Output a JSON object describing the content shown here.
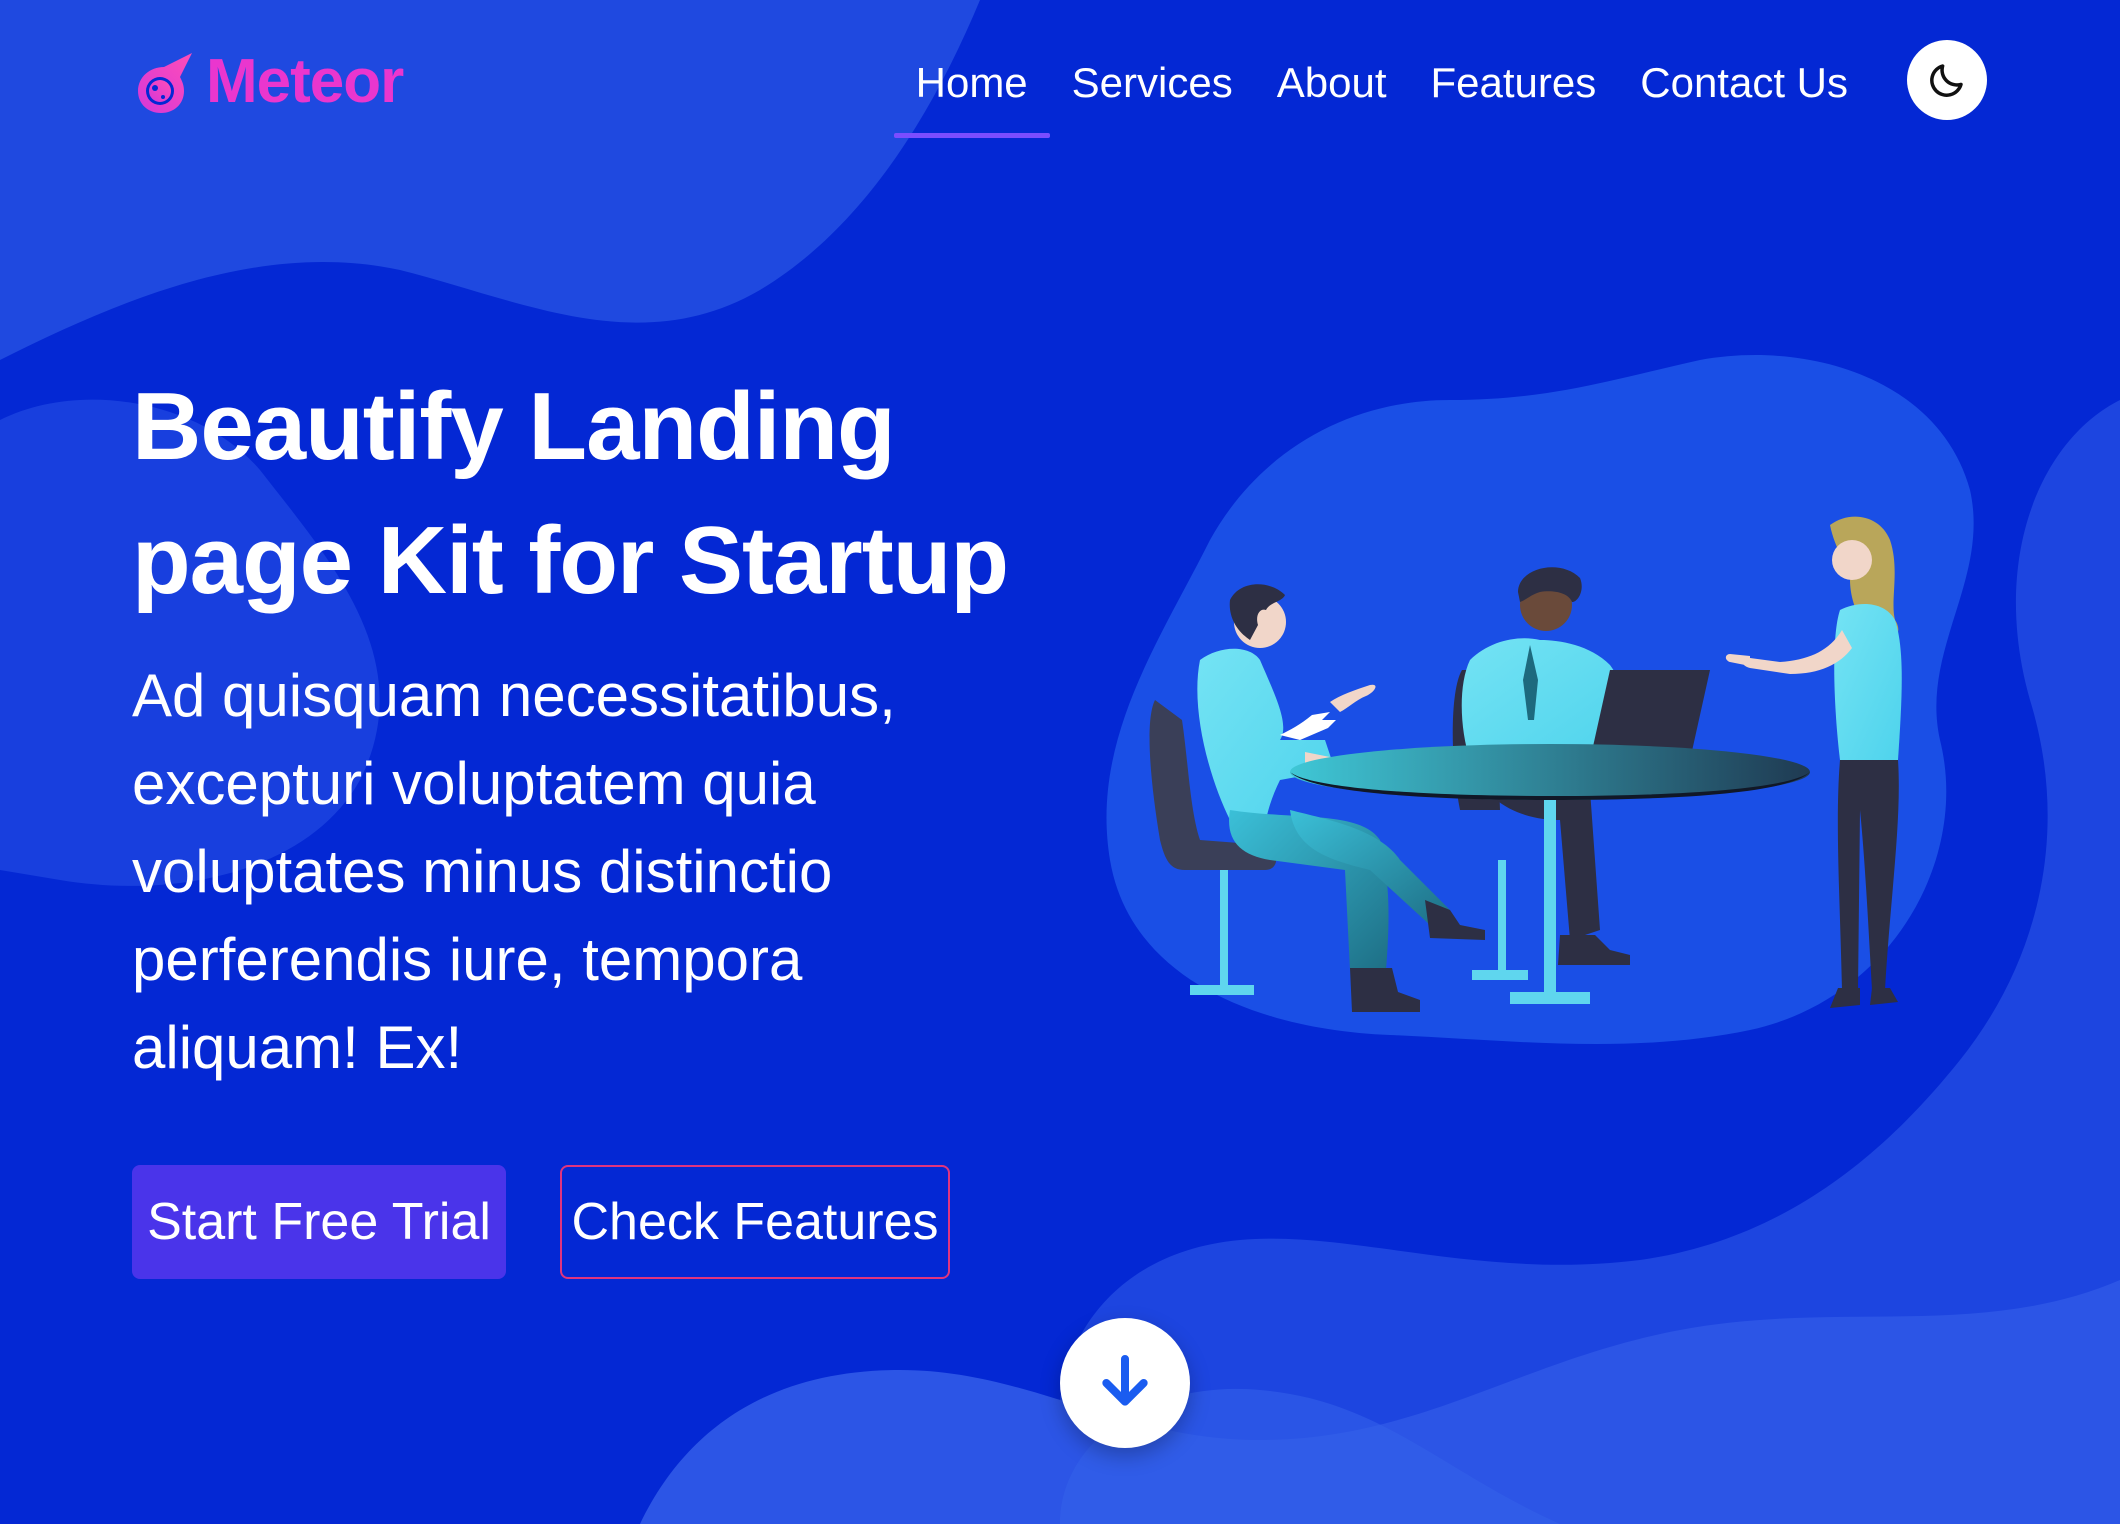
{
  "brand": {
    "name": "Meteor",
    "logo_icon": "meteor-logo-icon",
    "color": "#ea36ce"
  },
  "nav": {
    "items": [
      {
        "label": "Home",
        "active": true
      },
      {
        "label": "Services",
        "active": false
      },
      {
        "label": "About",
        "active": false
      },
      {
        "label": "Features",
        "active": false
      },
      {
        "label": "Contact Us",
        "active": false
      }
    ],
    "theme_toggle_icon": "moon-icon"
  },
  "hero": {
    "title_line1": "Beautify Landing",
    "title_line2": "page Kit for Startup",
    "description": "Ad quisquam necessitatibus, excepturi voluptatem quia voluptates minus distinctio perferendis iure, tempora aliquam! Ex!",
    "primary_button": "Start Free Trial",
    "secondary_button": "Check Features",
    "scroll_icon": "arrow-down-icon",
    "illustration": "team-meeting-illustration"
  },
  "colors": {
    "background": "#0428d4",
    "accent": "#4a34ea",
    "outline": "#e0347e",
    "active_underline": "#7b4dff"
  }
}
